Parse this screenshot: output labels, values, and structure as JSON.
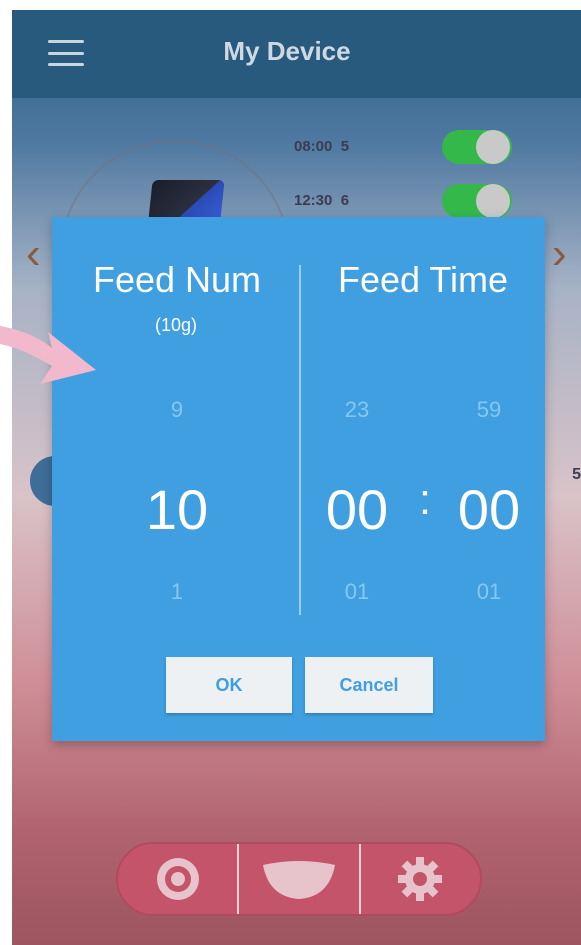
{
  "appbar": {
    "title": "My Device"
  },
  "schedule": [
    {
      "time": "08:00",
      "portions": "5",
      "enabled": true
    },
    {
      "time": "12:30",
      "portions": "6",
      "enabled": true
    }
  ],
  "background_fragments": {
    "right_value": "5"
  },
  "dialog": {
    "feed_num_header": "Feed Num",
    "feed_num_unit": "(10g)",
    "feed_time_header": "Feed Time",
    "num_prev": "9",
    "num_selected": "10",
    "num_next": "1",
    "hour_prev": "23",
    "hour_selected": "00",
    "hour_next": "01",
    "time_separator": ":",
    "minute_prev": "59",
    "minute_selected": "00",
    "minute_next": "01",
    "ok_label": "OK",
    "cancel_label": "Cancel"
  },
  "bottom_nav": [
    {
      "icon": "feeder-disc-icon"
    },
    {
      "icon": "food-bowl-icon"
    },
    {
      "icon": "gear-icon"
    }
  ],
  "colors": {
    "appbar": "#285a7e",
    "dialog": "#3f9fe0",
    "toggle_on": "#35b84a",
    "bottom_bar": "#c4546a",
    "arrow": "#f2b8cc"
  }
}
